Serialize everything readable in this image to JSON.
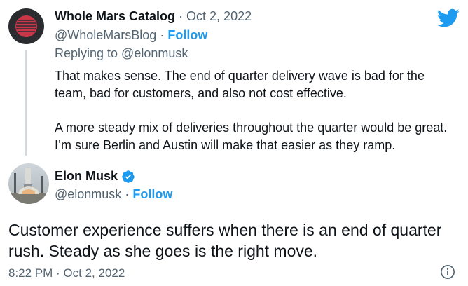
{
  "reply": {
    "author_name": "Whole Mars Catalog",
    "separator_date": "· Oct 2, 2022",
    "handle": "@WholeMarsBlog",
    "separator": "·",
    "follow_label": "Follow",
    "replying_to": "Replying to @elonmusk",
    "paragraph_1": "That makes sense. The end of quarter delivery wave is bad for the team, bad for customers, and also not cost effective.",
    "paragraph_2": "A more steady mix of deliveries throughout the quarter would be great. I’m sure Berlin and Austin will make that easier as they ramp."
  },
  "tweet": {
    "author_name": "Elon Musk",
    "handle": "@elonmusk",
    "separator": "·",
    "follow_label": "Follow",
    "text": "Customer experience suffers when there is an end of quarter rush. Steady as she goes is the right move.",
    "timestamp": "8:22 PM · Oct 2, 2022"
  },
  "colors": {
    "brand_blue": "#1d9bf0",
    "secondary_text": "#536471",
    "primary_text": "#0f1419"
  },
  "icons": {
    "logo": "twitter-bird-icon",
    "verified": "verified-badge-icon",
    "info": "info-icon"
  }
}
